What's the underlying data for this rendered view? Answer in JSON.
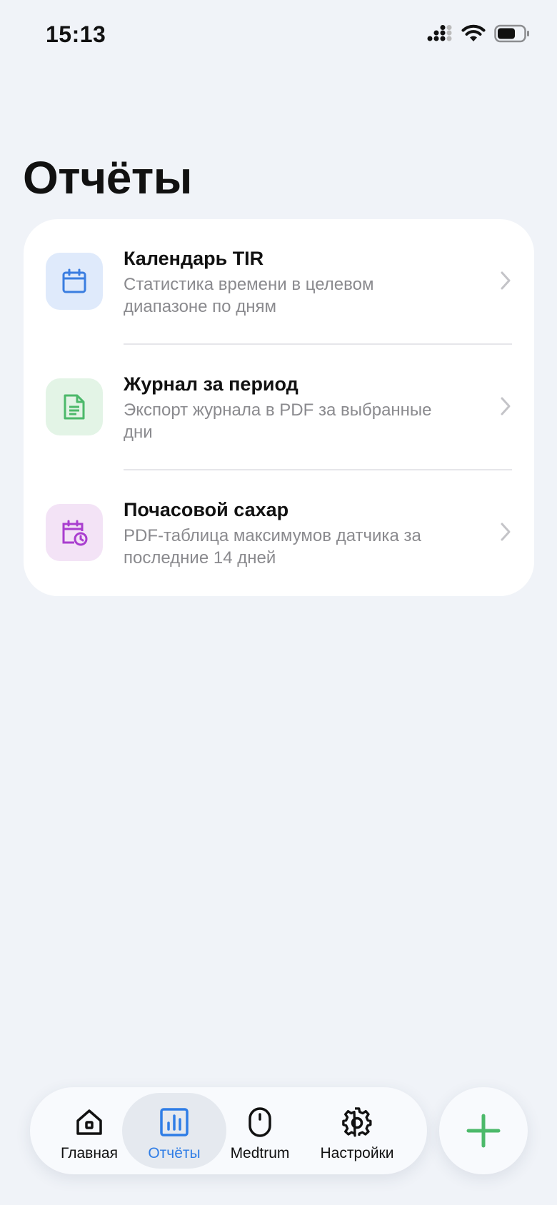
{
  "status_bar": {
    "time": "15:13",
    "icons": [
      "signal-icon",
      "wifi-icon",
      "battery-icon"
    ]
  },
  "page": {
    "title": "Отчёты"
  },
  "reports": [
    {
      "title": "Календарь TIR",
      "subtitle": "Статистика времени в целевом диапазоне по дням",
      "icon": "calendar-icon",
      "icon_color": "#3a7de0",
      "icon_bg": "#dfeafb"
    },
    {
      "title": "Журнал за период",
      "subtitle": "Экспорт журнала в PDF за выбранные дни",
      "icon": "document-icon",
      "icon_color": "#4cb96a",
      "icon_bg": "#e3f4e6"
    },
    {
      "title": "Почасовой сахар",
      "subtitle": "PDF-таблица максимумов датчика за последние 14 дней",
      "icon": "calendar-clock-icon",
      "icon_color": "#a93ecf",
      "icon_bg": "#f3e3f6"
    }
  ],
  "tab_bar": {
    "tabs": [
      {
        "label": "Главная",
        "icon": "home-icon",
        "active": false
      },
      {
        "label": "Отчёты",
        "icon": "bar-chart-icon",
        "active": true
      },
      {
        "label": "Medtrum",
        "icon": "sensor-icon",
        "active": false
      },
      {
        "label": "Настройки",
        "icon": "gear-icon",
        "active": false
      }
    ],
    "active_color": "#2f7de6"
  },
  "fab": {
    "icon": "plus-icon",
    "color": "#4cb96a"
  }
}
